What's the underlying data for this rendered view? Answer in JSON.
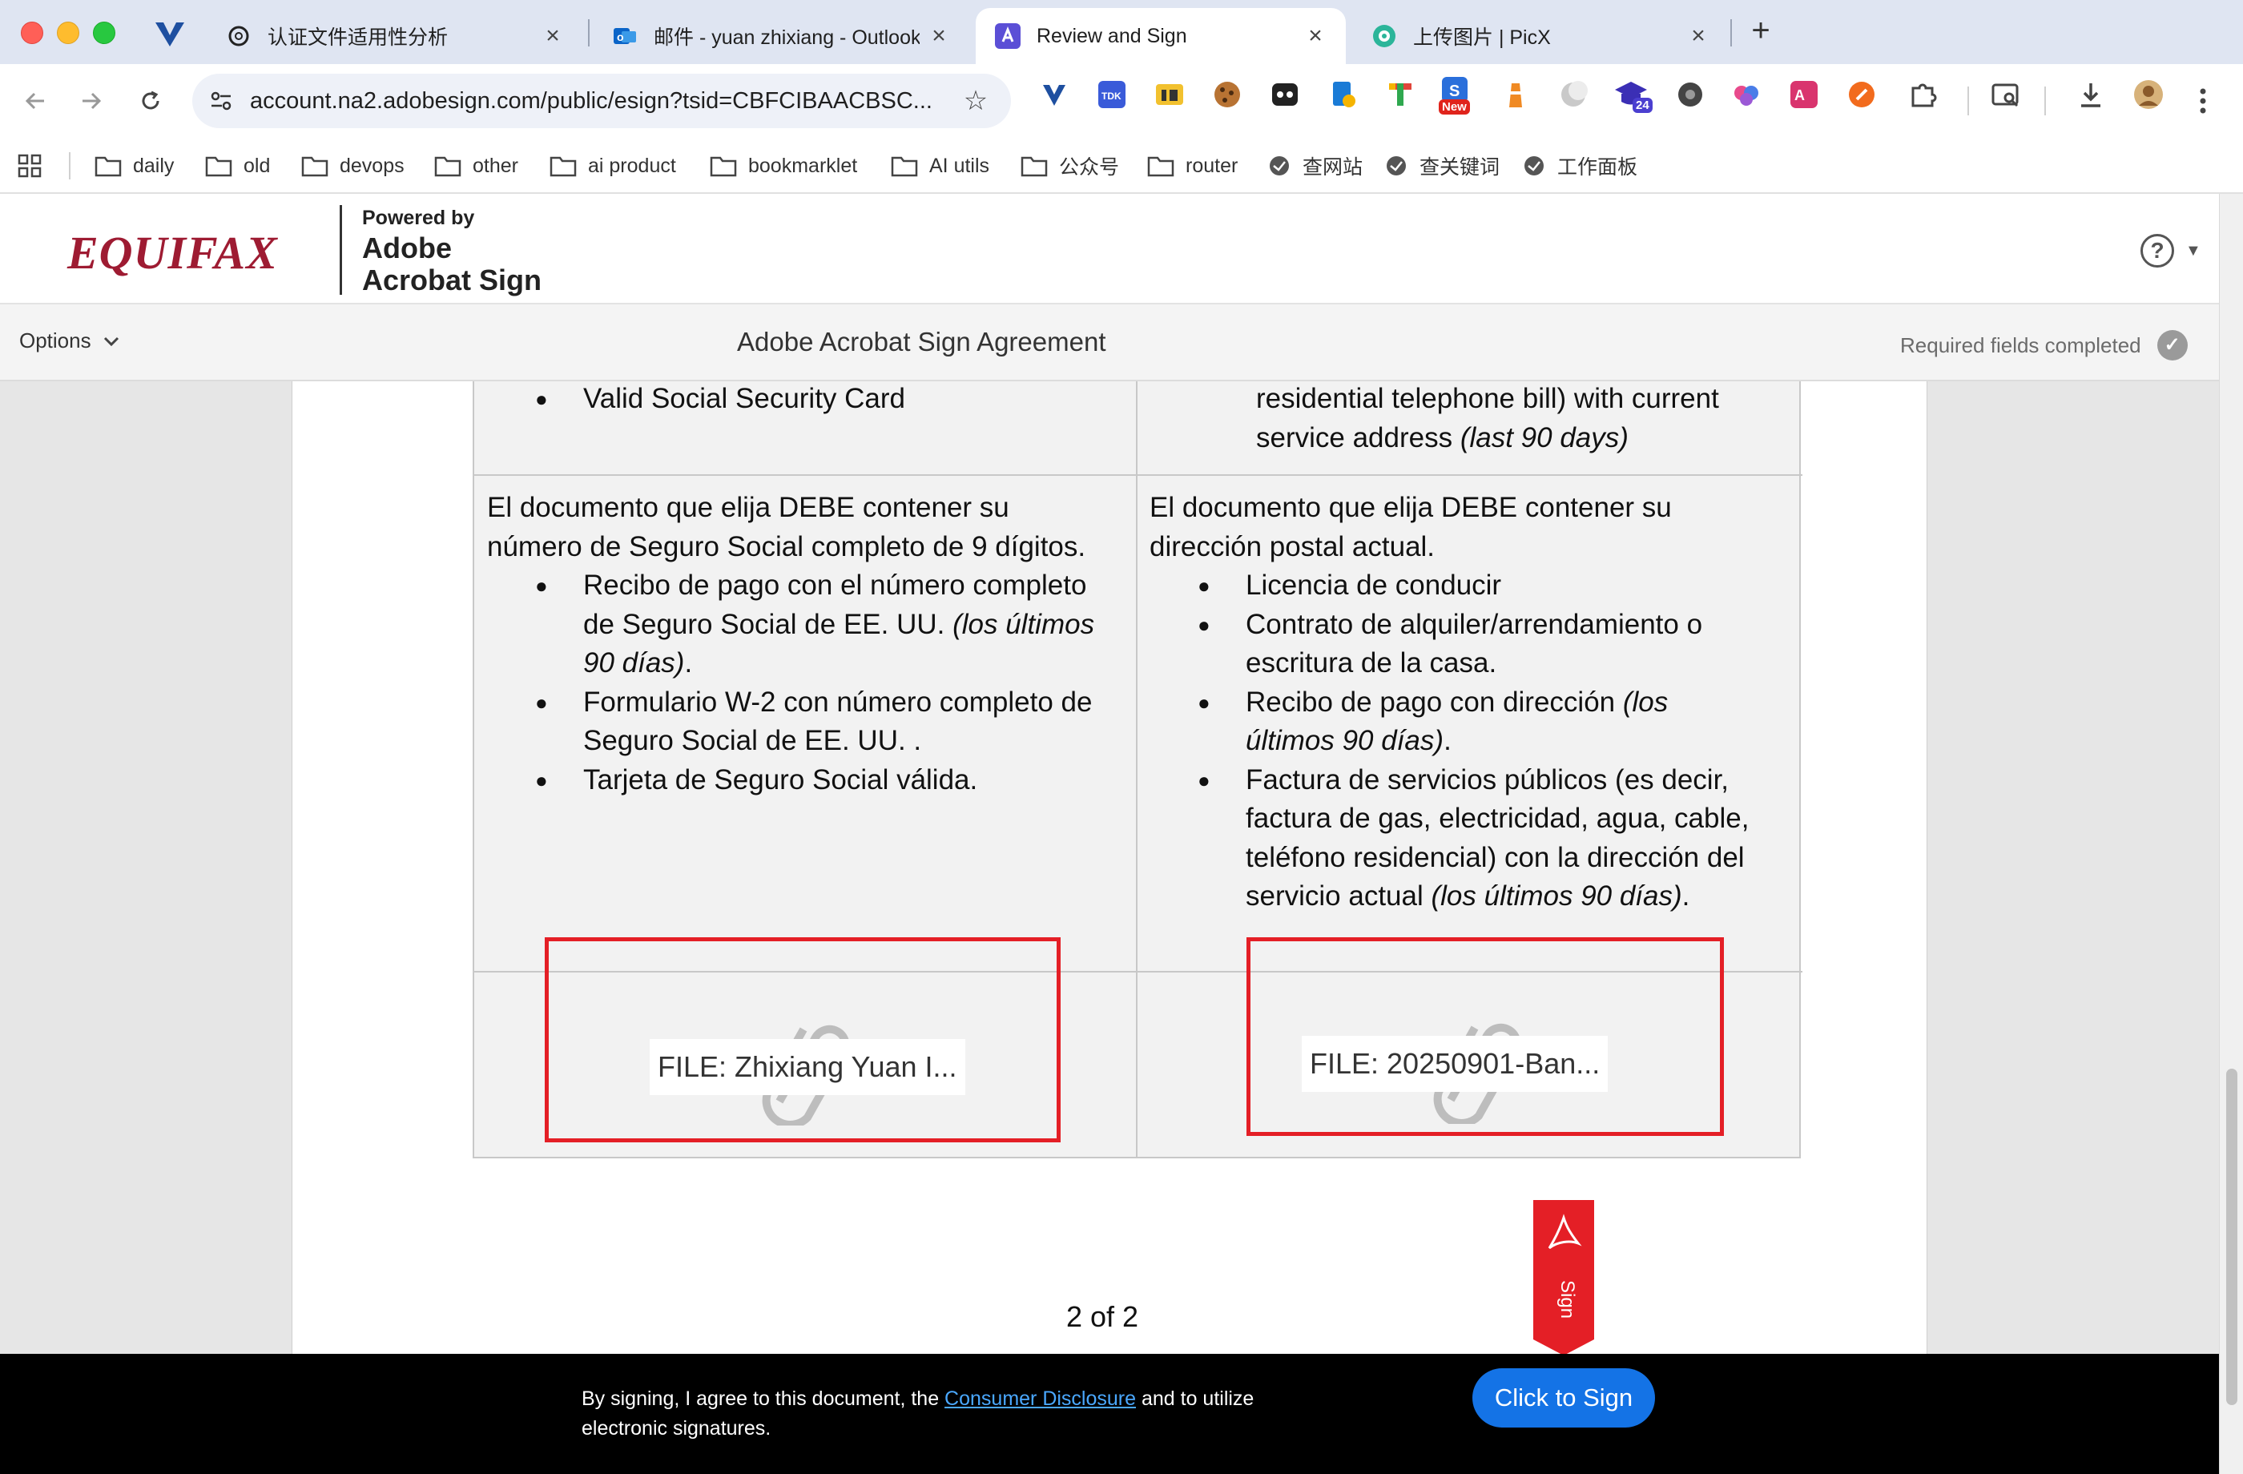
{
  "browser": {
    "tabs": [
      {
        "title": "认证文件适用性分析"
      },
      {
        "title": "邮件 - yuan zhixiang - Outlook"
      },
      {
        "title": "Review and Sign"
      },
      {
        "title": "上传图片 | PicX"
      }
    ],
    "url": "account.na2.adobesign.com/public/esign?tsid=CBFCIBAACBSC...",
    "extension_badges": {
      "new": "New",
      "count": "24"
    },
    "bookmarks": [
      "daily",
      "old",
      "devops",
      "other",
      "ai product",
      "bookmarklet",
      "AI utils",
      "公众号",
      "router",
      "查网站",
      "查关键词",
      "工作面板"
    ]
  },
  "header": {
    "brand": "EQUIFAX",
    "powered_by": "Powered by",
    "product_line1": "Adobe",
    "product_line2": "Acrobat Sign",
    "help": "?"
  },
  "options_bar": {
    "options_label": "Options",
    "title": "Adobe Acrobat Sign Agreement",
    "status": "Required fields completed"
  },
  "document": {
    "left_top_bullet": "Valid Social Security Card",
    "right_top_line1": "residential telephone bill) with current",
    "right_top_line2": "service address ",
    "right_top_line2_em": "(last 90 days)",
    "left_intro_line1": "El documento que elija DEBE contener su",
    "left_intro_line2": "número de Seguro Social completo de 9 dígitos.",
    "left_b1_line1": "Recibo de pago con el número completo",
    "left_b1_line2": "de Seguro Social de EE. UU. ",
    "left_b1_line2_em": "(los últimos",
    "left_b1_line3_em": "90 días)",
    "left_b1_line3_end": ".",
    "left_b2_line1": "Formulario W-2 con número completo de",
    "left_b2_line2": "Seguro Social de EE. UU. .",
    "left_b3": "Tarjeta de Seguro Social válida.",
    "right_intro_line1": "El documento que elija DEBE contener su",
    "right_intro_line2": "dirección postal actual.",
    "right_b1": "Licencia de conducir",
    "right_b2_line1": "Contrato de alquiler/arrendamiento o",
    "right_b2_line2": "escritura de la casa.",
    "right_b3_line1": "Recibo de pago con dirección ",
    "right_b3_line1_em": "(los",
    "right_b3_line2_em": "últimos 90 días)",
    "right_b3_line2_end": ".",
    "right_b4_line1": "Factura de servicios públicos (es decir,",
    "right_b4_line2": "factura de gas, electricidad, agua, cable,",
    "right_b4_line3": "teléfono residencial) con la dirección del",
    "right_b4_line4": "servicio actual ",
    "right_b4_line4_em": "(los últimos 90 días)",
    "right_b4_line4_end": ".",
    "file_left": "FILE: Zhixiang Yuan I...",
    "file_right": "FILE: 20250901-Ban...",
    "page_indicator": "2 of 2",
    "sign_flag": "Sign"
  },
  "sign_bar": {
    "text_before": "By signing, I agree to this document, the ",
    "link": "Consumer Disclosure",
    "text_after": " and to utilize electronic signatures.",
    "button": "Click to Sign"
  },
  "colors": {
    "brand": "#9e1b32",
    "accent": "#1473e6",
    "highlight": "#e41f26"
  }
}
